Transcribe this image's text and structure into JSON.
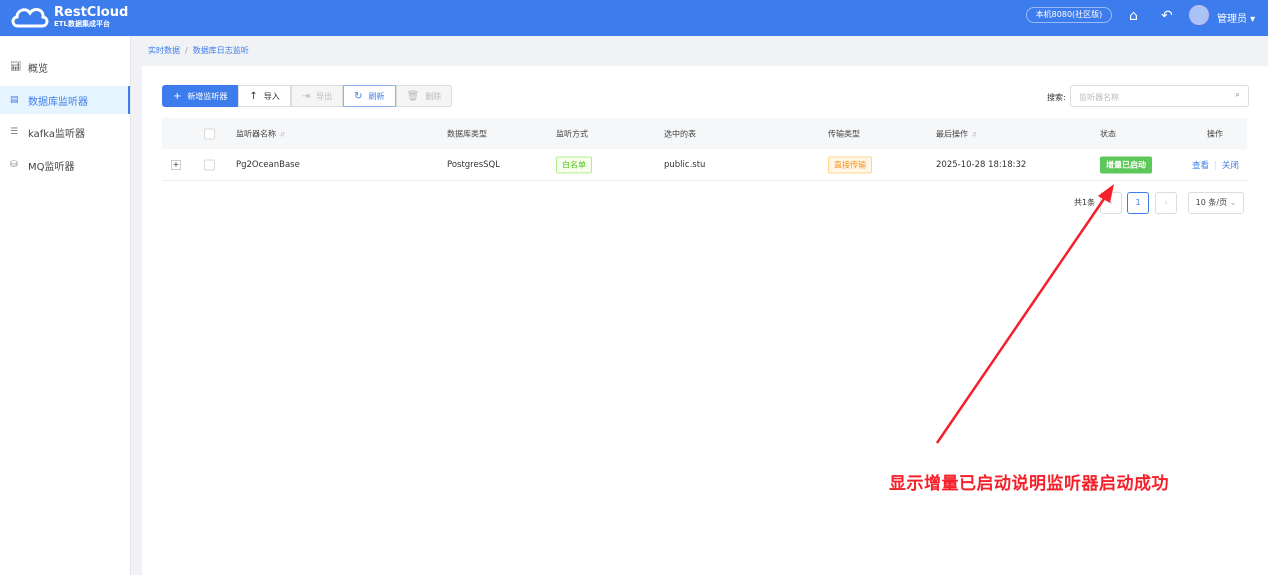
{
  "header": {
    "brand": "RestCloud",
    "subtitle": "ETL数据集成平台",
    "env": "本机8080(社区版)",
    "user": "管理员"
  },
  "sidebar": {
    "items": [
      {
        "label": "概览",
        "icon": "chart-icon"
      },
      {
        "label": "数据库监听器",
        "icon": "database-icon",
        "active": true
      },
      {
        "label": "kafka监听器",
        "icon": "kafka-icon"
      },
      {
        "label": "MQ监听器",
        "icon": "mq-icon"
      }
    ]
  },
  "breadcrumb": [
    "实时数据",
    "数据库日志监听"
  ],
  "toolbar": {
    "add": "新增监听器",
    "import": "导入",
    "export": "导出",
    "refresh": "刷新",
    "delete": "删除"
  },
  "search": {
    "label": "搜索:",
    "placeholder": "监听器名称"
  },
  "table": {
    "columns": [
      "监听器名称",
      "数据库类型",
      "监听方式",
      "选中的表",
      "传输类型",
      "最后操作",
      "状态",
      "操作"
    ],
    "rows": [
      {
        "name": "Pg2OceanBase",
        "db_type": "PostgresSQL",
        "mode": "白名单",
        "table": "public.stu",
        "transfer": "直接传输",
        "last_op": "2025-10-28 18:18:32",
        "status": "增量已启动",
        "actions": [
          "查看",
          "关闭"
        ]
      }
    ]
  },
  "pagination": {
    "total": "共1条",
    "page": "1",
    "size": "10 条/页"
  },
  "annotation": {
    "text": "显示增量已启动说明监听器启动成功",
    "color": "#f5202a"
  }
}
